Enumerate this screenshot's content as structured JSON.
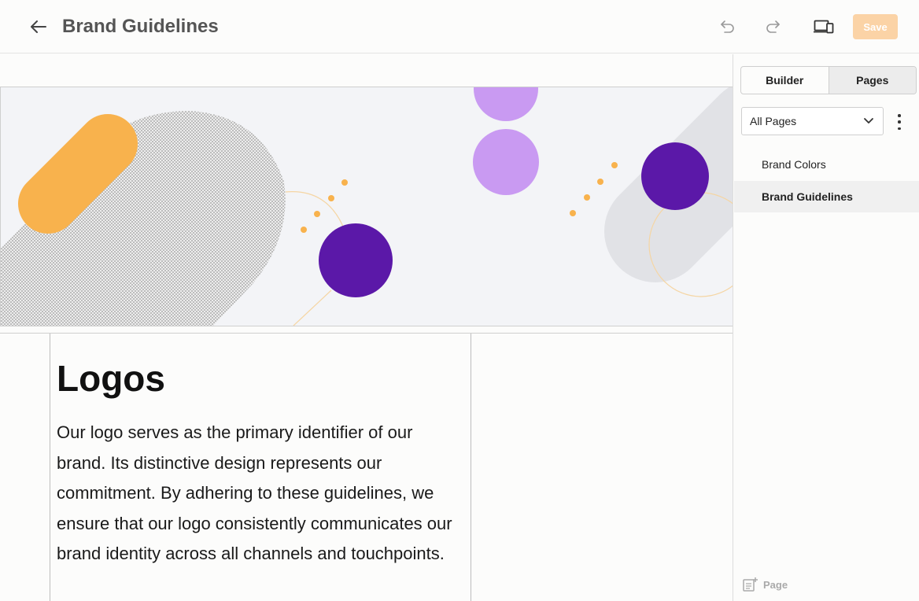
{
  "header": {
    "title": "Brand Guidelines",
    "save_label": "Save",
    "icons": [
      "back-arrow-icon",
      "undo-icon",
      "redo-icon",
      "device-preview-icon"
    ]
  },
  "content": {
    "heading": "Logos",
    "body": "Our logo serves as the primary identifier of our brand. Its distinctive design represents our commitment. By adhering to these guidelines, we ensure that our logo consistently communicates our brand identity across all channels and touchpoints."
  },
  "panel": {
    "tabs": [
      {
        "label": "Builder",
        "active": false
      },
      {
        "label": "Pages",
        "active": true
      }
    ],
    "filter": {
      "selected": "All Pages"
    },
    "pages": [
      {
        "label": "Brand Colors",
        "selected": false
      },
      {
        "label": "Brand Guidelines",
        "selected": true
      }
    ],
    "add_page_label": "Page"
  },
  "colors": {
    "accent_orange": "#f8b24d",
    "purple_dark": "#5b18a8",
    "purple_light": "#c99af2",
    "save_disabled": "#fbd3a6"
  }
}
